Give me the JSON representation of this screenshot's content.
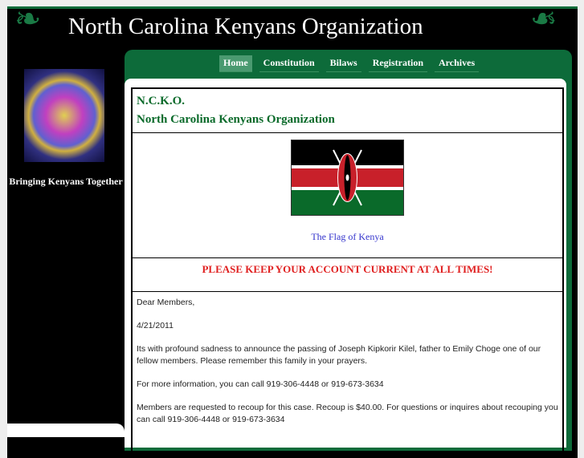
{
  "header": {
    "title": "North Carolina Kenyans Organization"
  },
  "sidebar": {
    "tagline": "Bringing Kenyans Together"
  },
  "nav": [
    {
      "label": "Home"
    },
    {
      "label": "Constitution"
    },
    {
      "label": "Bilaws"
    },
    {
      "label": "Registration"
    },
    {
      "label": "Archives"
    }
  ],
  "content": {
    "abbr": "N.C.K.O.",
    "org_name": "North Carolina Kenyans Organization",
    "flag_caption": "The Flag of Kenya",
    "notice": "PLEASE KEEP YOUR ACCOUNT CURRENT AT ALL TIMES!",
    "paragraphs": [
      "Dear Members,",
      "4/21/2011",
      "Its with profound sadness to announce the passing of Joseph Kipkorir Kilel, father to Emily Choge one of our fellow members. Please remember this family in your prayers.",
      "For more information, you can call 919-306-4448 or 919-673-3634",
      "Members are requested to recoup for this case. Recoup is $40.00. For questions or inquires about recouping you can call 919-306-4448 or 919-673-3634"
    ]
  },
  "colors": {
    "green": "#0d6b3a",
    "notice": "#e02020",
    "link": "#3333cc"
  }
}
